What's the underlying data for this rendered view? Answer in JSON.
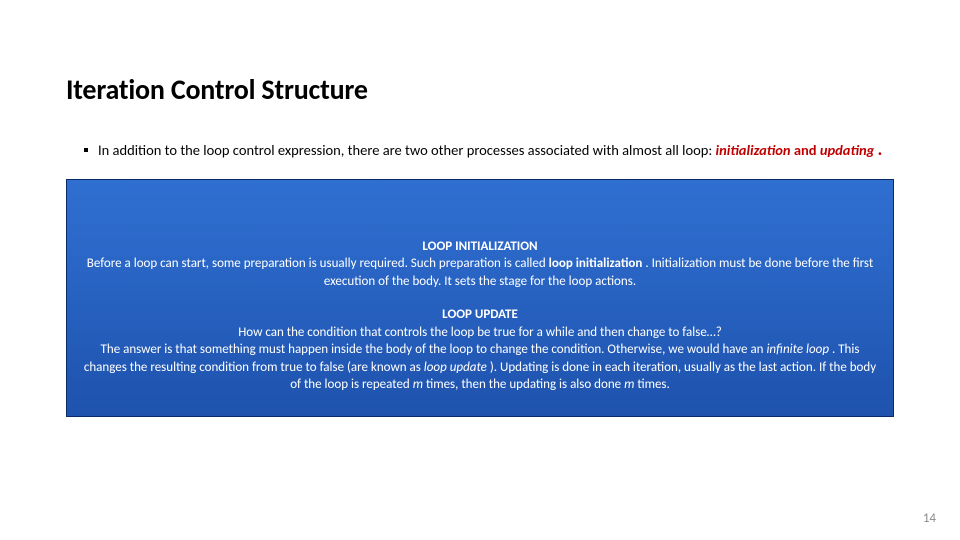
{
  "slide": {
    "title": "Iteration Control Structure",
    "bullet": {
      "lead": "In addition to the loop control expression, there are two other processes associated with almost all loop: ",
      "kw1": "initialization",
      "and": " and ",
      "kw2": "updating",
      "dot": "."
    },
    "card": {
      "init": {
        "title": "LOOP INITIALIZATION",
        "p1a": "Before a loop can start, some preparation is usually required. Such preparation is called ",
        "p1b": "loop initialization",
        "p1c": ". Initialization must be done before the first execution of the body. It sets the stage for the loop actions."
      },
      "update": {
        "title": "LOOP UPDATE",
        "q": "How can the condition that controls the loop be true for a while and then change to false…?",
        "p2a": "The answer is that something must happen inside the body of the loop to change the condition. Otherwise, we would have an ",
        "p2b": "infinite loop",
        "p2c": ". This changes the resulting condition from true to false (are known as ",
        "p2d": "loop update",
        "p2e": "). Updating is done in each iteration, usually as the last action. If the body of the loop is repeated ",
        "p2f": "m",
        "p2g": " times, then the updating is also done ",
        "p2h": "m",
        "p2i": " times."
      }
    },
    "page": "14"
  }
}
